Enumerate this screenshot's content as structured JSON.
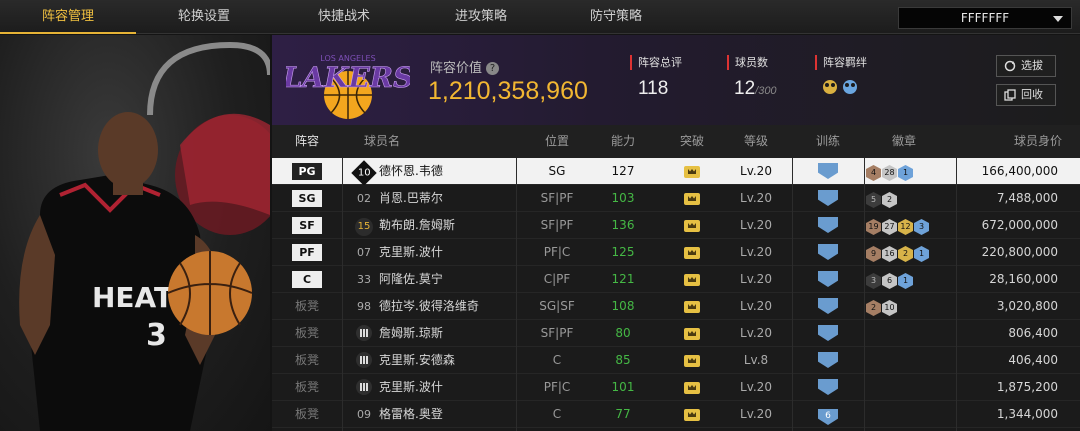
{
  "tabs": [
    {
      "label": "阵容管理",
      "active": true
    },
    {
      "label": "轮换设置",
      "active": false
    },
    {
      "label": "快捷战术",
      "active": false
    },
    {
      "label": "进攻策略",
      "active": false
    },
    {
      "label": "防守策略",
      "active": false
    }
  ],
  "dropdown": {
    "value": "FFFFFFF"
  },
  "player_art": {
    "jersey_team": "HEAT",
    "jersey_number": "3"
  },
  "team": {
    "logo_top": "LOS ANGELES",
    "logo_name": "LAKERS",
    "value_label": "阵容价值",
    "value": "1,210,358,960",
    "rating_label": "阵容总评",
    "rating": "118",
    "count_label": "球员数",
    "count": "12",
    "count_max": "/300",
    "bond_label": "阵容羁绊"
  },
  "buttons": {
    "select": "选拔",
    "recall": "回收"
  },
  "columns": {
    "lineup": "阵容",
    "name": "球员名",
    "position": "位置",
    "ability": "能力",
    "breakthrough": "突破",
    "level": "等级",
    "training": "训练",
    "badges": "徽章",
    "salary": "球员身价"
  },
  "rows": [
    {
      "slot": "PG",
      "number": "10",
      "number_style": "diamond",
      "name": "德怀恩.韦德",
      "pos": "SG",
      "ability": "127",
      "level": "Lv.20",
      "train": "",
      "badges": [
        {
          "t": "b",
          "v": "4"
        },
        {
          "t": "s",
          "v": "28"
        },
        {
          "t": "p",
          "v": "1"
        }
      ],
      "salary": "166,400,000",
      "selected": true
    },
    {
      "slot": "SG",
      "number": "02",
      "number_style": "plain",
      "name": "肖恩.巴蒂尔",
      "pos": "SF|PF",
      "ability": "103",
      "level": "Lv.20",
      "train": "",
      "badges": [
        {
          "t": "k",
          "v": "5"
        },
        {
          "t": "s",
          "v": "2"
        }
      ],
      "salary": "7,488,000"
    },
    {
      "slot": "SF",
      "number": "15",
      "number_style": "circle",
      "name": "勒布朗.詹姆斯",
      "pos": "SF|PF",
      "ability": "136",
      "level": "Lv.20",
      "train": "",
      "badges": [
        {
          "t": "b",
          "v": "19"
        },
        {
          "t": "s",
          "v": "27"
        },
        {
          "t": "g",
          "v": "12"
        },
        {
          "t": "p",
          "v": "3"
        }
      ],
      "salary": "672,000,000"
    },
    {
      "slot": "PF",
      "number": "07",
      "number_style": "plain",
      "name": "克里斯.波什",
      "pos": "PF|C",
      "ability": "125",
      "level": "Lv.20",
      "train": "",
      "badges": [
        {
          "t": "b",
          "v": "9"
        },
        {
          "t": "s",
          "v": "16"
        },
        {
          "t": "g",
          "v": "2"
        },
        {
          "t": "p",
          "v": "1"
        }
      ],
      "salary": "220,800,000"
    },
    {
      "slot": "C",
      "number": "33",
      "number_style": "plain",
      "name": "阿隆佐.莫宁",
      "pos": "C|PF",
      "ability": "121",
      "level": "Lv.20",
      "train": "",
      "badges": [
        {
          "t": "k",
          "v": "3"
        },
        {
          "t": "s",
          "v": "6"
        },
        {
          "t": "p",
          "v": "1"
        }
      ],
      "salary": "28,160,000"
    },
    {
      "slot": "板凳",
      "number": "98",
      "number_style": "plain",
      "name": "德拉岑.彼得洛维奇",
      "pos": "SG|SF",
      "ability": "108",
      "level": "Lv.20",
      "train": "",
      "badges": [
        {
          "t": "b",
          "v": "2"
        },
        {
          "t": "s",
          "v": "10"
        }
      ],
      "salary": "3,020,800"
    },
    {
      "slot": "板凳",
      "number": "",
      "number_style": "bars",
      "name": "詹姆斯.琼斯",
      "pos": "SF|PF",
      "ability": "80",
      "level": "Lv.20",
      "train": "",
      "badges": [],
      "salary": "806,400"
    },
    {
      "slot": "板凳",
      "number": "",
      "number_style": "bars",
      "name": "克里斯.安德森",
      "pos": "C",
      "ability": "85",
      "level": "Lv.8",
      "train": "",
      "badges": [],
      "salary": "406,400"
    },
    {
      "slot": "板凳",
      "number": "",
      "number_style": "bars",
      "name": "克里斯.波什",
      "pos": "PF|C",
      "ability": "101",
      "level": "Lv.20",
      "train": "",
      "badges": [],
      "salary": "1,875,200"
    },
    {
      "slot": "板凳",
      "number": "09",
      "number_style": "plain",
      "name": "格雷格.奥登",
      "pos": "C",
      "ability": "77",
      "level": "Lv.20",
      "train": "6",
      "badges": [],
      "salary": "1,344,000"
    }
  ],
  "colors": {
    "accent": "#e6b336",
    "value_gold": "#f2b732",
    "ability_green": "#45b845",
    "lakers_purple": "#552583"
  }
}
